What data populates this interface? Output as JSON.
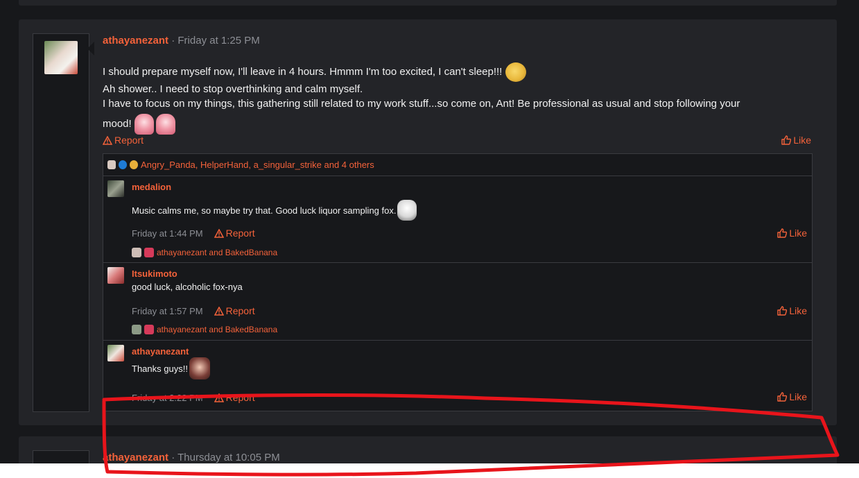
{
  "thread": {
    "post": {
      "author": "athayanezant",
      "date": "Friday at 1:25 PM",
      "lines": [
        "I should prepare myself now, I'll leave in 4 hours. Hmmm I'm too excited, I can't sleep!!!",
        "Ah shower.. I need to stop overthinking and calm myself.",
        "I have to focus on my things, this gathering still related to my work stuff...so come on, Ant! Be professional as usual and stop following your",
        "mood!"
      ],
      "report_label": "Report",
      "like_label": "Like",
      "reactions_text": "Angry_Panda, HelperHand, a_singular_strike and 4 others"
    },
    "replies": [
      {
        "author": "medalion",
        "text": "Music calms me, so maybe try that. Good luck liquor sampling fox.",
        "date": "Friday at 1:44 PM",
        "report_label": "Report",
        "like_label": "Like",
        "reactions_text": "athayanezant and BakedBanana"
      },
      {
        "author": "Itsukimoto",
        "text": "good luck, alcoholic fox-nya",
        "date": "Friday at 1:57 PM",
        "report_label": "Report",
        "like_label": "Like",
        "reactions_text": "athayanezant and BakedBanana"
      },
      {
        "author": "athayanezant",
        "text": "Thanks guys!!",
        "date": "Friday at 2:22 PM",
        "report_label": "Report",
        "like_label": "Like"
      }
    ],
    "next_post": {
      "author": "athayanezant",
      "date": "Thursday at 10:05 PM"
    }
  },
  "colors": {
    "accent": "#f4623a",
    "background": "#17181b",
    "card": "#232428",
    "annotation": "#e8141b"
  },
  "icons": [
    "warning-icon",
    "thumbs-up-icon"
  ]
}
